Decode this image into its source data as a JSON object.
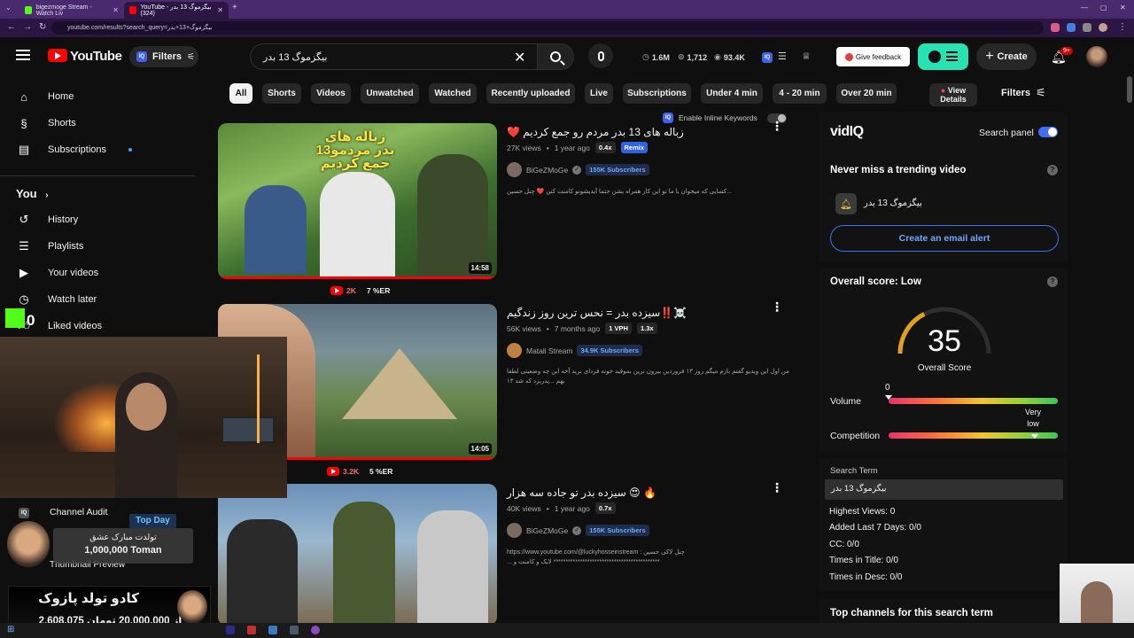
{
  "browser": {
    "tabs": [
      {
        "label": "bigezmoge Stream - Watch Liv"
      },
      {
        "label": "YouTube - بیگزموگ 13 بدر (324)"
      }
    ],
    "url": "youtube.com/results?search_query=بیگزموگ+13+بدر"
  },
  "header": {
    "logo_text": "YouTube",
    "filters_label": "Filters",
    "search_value": "بیگزموگ 13 بدر",
    "stats": {
      "views": "1.6M",
      "count": "1,712",
      "eye": "93.4K"
    },
    "feedback_label": "Give feedback",
    "create_label": "Create",
    "notif_badge": "9+"
  },
  "sidebar": {
    "items": [
      {
        "label": "Home",
        "icon": "home-icon"
      },
      {
        "label": "Shorts",
        "icon": "shorts-icon"
      },
      {
        "label": "Subscriptions",
        "icon": "subscriptions-icon"
      }
    ],
    "you_label": "You",
    "you_items": [
      {
        "label": "History",
        "icon": "history-icon"
      },
      {
        "label": "Playlists",
        "icon": "playlists-icon"
      },
      {
        "label": "Your videos",
        "icon": "your-videos-icon"
      },
      {
        "label": "Watch later",
        "icon": "watch-later-icon"
      },
      {
        "label": "Liked videos",
        "icon": "liked-icon"
      }
    ]
  },
  "chips": [
    "All",
    "Shorts",
    "Videos",
    "Unwatched",
    "Watched",
    "Recently uploaded",
    "Live",
    "Subscriptions",
    "Under 4 min",
    "4 - 20 min",
    "Over 20 min"
  ],
  "view_details_label": "View Details",
  "filters_chip_label": "Filters",
  "inline_keywords_label": "Enable Inline Keywords",
  "results": [
    {
      "title": "زباله های 13 بدر مردم رو جمع کردیم ❤️",
      "views": "27K views",
      "age": "1 year ago",
      "pill1": "0.4x",
      "pill2": "Remix",
      "channel": "BiGeZMoGe",
      "subs": "155K Subscribers",
      "desc": "...کسایی که میخوان با ما تو این کار همراه بشن حتما آیدیشونو کامنت کنن ❤️ چنل حسین",
      "duration": "14:58",
      "under_count": "2K",
      "under_er": "7 %ER"
    },
    {
      "title": "☠️‼️سیزده بدر = نحس ترین روز زندگیم",
      "views": "56K views",
      "age": "7 months ago",
      "pill1": "1 VPH",
      "pill2": "1.3x",
      "channel": "Matali Stream",
      "subs": "34.9K Subscribers",
      "desc": "من اول این ویدیو گفتم بازم میگم روز ۱۳ فروردین بیرون نرین بموقید خونه فردای برید آخه این چه وضعیتی لطفا بهم ...پدربزد که شد ۱۳",
      "duration": "14:05",
      "under_count": "3.2K",
      "under_er": "5 %ER"
    },
    {
      "title": "🔥 😍 سیزده بدر تو جاده سه هزار",
      "views": "40K views",
      "age": "1 year ago",
      "pill1": "0.7x",
      "channel": "BiGeZMoGe",
      "subs": "155K Subscribers",
      "desc": "چنل لاکی حسین : https://www.youtube.com/@luckyhosseinstream ******************************************** لایک و کامنت و ..."
    }
  ],
  "vidiq": {
    "logo": "vidIQ",
    "search_panel_label": "Search panel",
    "trending_title": "Never miss a trending video",
    "keyword": "بیگزموگ 13 بدر",
    "email_alert_label": "Create an email alert",
    "overall_title": "Overall score: Low",
    "score": "35",
    "score_label": "Overall Score",
    "score_value": 35,
    "volume_label": "Volume",
    "volume_value": "0",
    "competition_label": "Competition",
    "competition_value": "Very low",
    "search_term_label": "Search Term",
    "search_term_value": "بیگزموگ 13 بدر",
    "stats": [
      "Highest Views: 0",
      "Added Last 7 Days: 0/0",
      "CC: 0/0",
      "Times in Title: 0/0",
      "Times in Desc: 0/0"
    ],
    "top_channels_title": "Top channels for this search term"
  },
  "overlay": {
    "kick_count": "0",
    "channel_audit": "Channel Audit",
    "thumbnail_preview": "Thumbnail Preview",
    "top_day": "Top Day",
    "donation_msg": "تولدت مبارک عشق",
    "donation_amount": "1,000,000 Toman",
    "goal_title": "کادو تولد پازوک",
    "goal_progress": "2,608,075 از 20,000,000 تومان"
  }
}
